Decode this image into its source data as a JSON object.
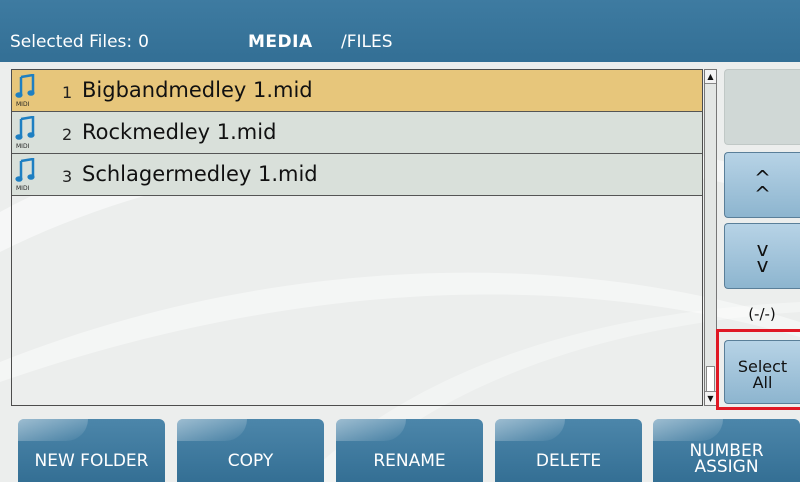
{
  "header": {
    "selected_label": "Selected Files:",
    "selected_count": "0",
    "device": "MEDIA",
    "path": "/FILES"
  },
  "files": [
    {
      "index": "1",
      "name": "Bigbandmedley 1.mid",
      "type_icon": "midi-file-icon",
      "selected": true
    },
    {
      "index": "2",
      "name": "Rockmedley 1.mid",
      "type_icon": "midi-file-icon",
      "selected": false
    },
    {
      "index": "3",
      "name": "Schlagermedley 1.mid",
      "type_icon": "midi-file-icon",
      "selected": false
    }
  ],
  "midi_icon_text": "MIDI",
  "side": {
    "page_up": "^^",
    "page_down": "vv",
    "page_indicator": "(-/-)",
    "select_all_line1": "Select",
    "select_all_line2": "All"
  },
  "bottom": {
    "new_folder": "NEW FOLDER",
    "copy": "COPY",
    "rename": "RENAME",
    "delete": "DELETE",
    "number_assign_line1": "NUMBER",
    "number_assign_line2": "ASSIGN"
  },
  "colors": {
    "header": "#3e7ba1",
    "selected_row": "#e7c67b",
    "row": "#d9e0da",
    "button": "#4c86aa",
    "highlight": "#e01824"
  }
}
